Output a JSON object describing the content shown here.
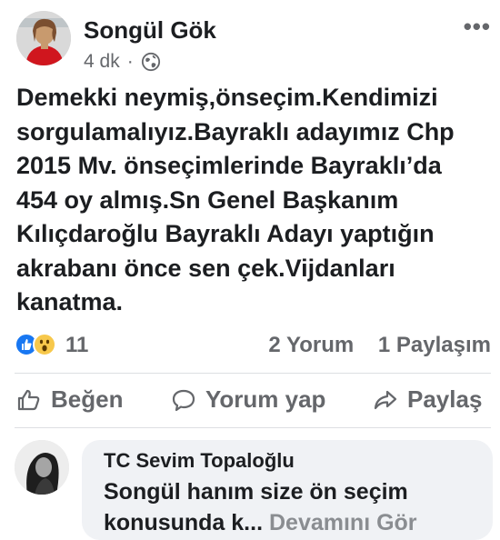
{
  "post": {
    "author": "Songül Gök",
    "time": "4 dk",
    "separator": "·",
    "privacy_icon": "globe-icon",
    "more_icon": "more-dots-icon",
    "more_label": "•••",
    "text": "Demekki neymiş,önseçim.Kendimizi\nsorgulamalıyız.Bayraklı adayımız Chp\n2015 Mv. önseçimlerinde Bayraklı’da\n454 oy almış.Sn Genel Başkanım\nKılıçdaroğlu Bayraklı Adayı yaptığın\nakrabanı önce sen çek.Vijdanları\nkanatma."
  },
  "reactions": {
    "icons": [
      "like-reaction-icon",
      "wow-reaction-icon"
    ],
    "count": "11",
    "comments": "2 Yorum",
    "shares": "1 Paylaşım"
  },
  "actions": {
    "like": "Beğen",
    "comment": "Yorum yap",
    "share": "Paylaş"
  },
  "comment": {
    "author": "TC Sevim Topaloğlu",
    "text_line1": "Songül hanım size ön seçim",
    "text_line2": "konusunda k...",
    "see_more": "Devamını Gör"
  },
  "colors": {
    "primary_text": "#1c1e21",
    "secondary_text": "#65676b",
    "like_blue": "#1877f2",
    "wow_yellow": "#f7c84b",
    "bubble_bg": "#f0f2f5",
    "divider": "#dddfe2"
  }
}
